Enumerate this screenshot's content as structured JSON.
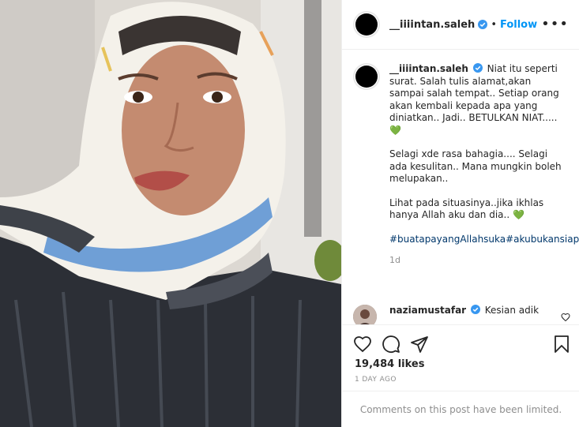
{
  "post": {
    "username": "__iiiintan.saleh",
    "follow_label": "Follow",
    "more_label": "•••",
    "caption": {
      "username": "__iiiintan.saleh",
      "paragraph1": "Niat itu seperti surat. Salah tulis alamat,akan sampai salah tempat.. Setiap orang akan kembali kepada apa yang diniatkan.. Jadi.. BETULKAN NIAT.....💚",
      "paragraph2": "Selagi xde rasa bahagia.... Selagi ada kesulitan.. Mana mungkin boleh melupakan..",
      "paragraph3": "Lihat pada situasinya..jika ikhlas hanya Allah aku dan dia.. 💚",
      "hashtags": "#buatapayangAllahsuka#akubukansiapasiapa",
      "time": "1d"
    },
    "comment": {
      "username": "naziamustafar",
      "text": "Kesian adik"
    },
    "likes": "19,484 likes",
    "posted_ago": "1 DAY AGO",
    "comments_limited": "Comments on this post have been limited."
  },
  "icons": {
    "like": "heart-icon",
    "comment": "comment-icon",
    "share": "share-icon",
    "save": "bookmark-icon",
    "verified": "verified-badge-icon"
  },
  "colors": {
    "link": "#0095f6",
    "hashtag": "#00376b",
    "verified": "#3897f0",
    "muted": "#8e8e8e"
  }
}
